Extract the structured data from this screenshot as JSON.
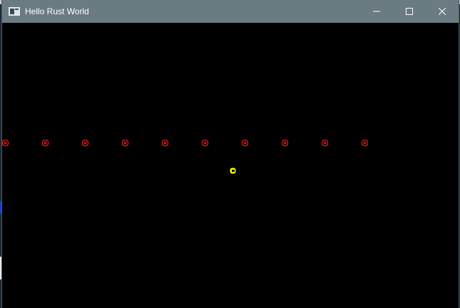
{
  "window": {
    "title": "Hello Rust World",
    "controls": [
      "minimize",
      "maximize",
      "close"
    ]
  },
  "colors": {
    "titlebar": "#6b7b82",
    "playfield": "#000000",
    "enemy": "#ff2020",
    "player": "#ffff00"
  },
  "game": {
    "enemies": [
      {
        "id": 1,
        "icon": "enemy-sprite-icon"
      },
      {
        "id": 2,
        "icon": "enemy-sprite-icon"
      },
      {
        "id": 3,
        "icon": "enemy-sprite-icon"
      },
      {
        "id": 4,
        "icon": "enemy-sprite-icon"
      },
      {
        "id": 5,
        "icon": "enemy-sprite-icon"
      },
      {
        "id": 6,
        "icon": "enemy-sprite-icon"
      },
      {
        "id": 7,
        "icon": "enemy-sprite-icon"
      },
      {
        "id": 8,
        "icon": "enemy-sprite-icon"
      },
      {
        "id": 9,
        "icon": "enemy-sprite-icon"
      },
      {
        "id": 10,
        "icon": "enemy-sprite-icon"
      }
    ],
    "player": {
      "icon": "player-sprite-icon"
    }
  }
}
